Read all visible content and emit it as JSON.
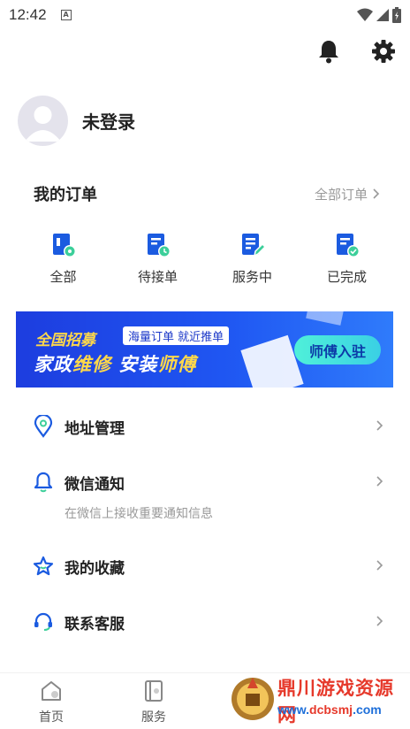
{
  "status_bar": {
    "time": "12:42",
    "notice_glyph": "A"
  },
  "topbar": {
    "icons": [
      "bell-icon",
      "gear-icon"
    ]
  },
  "profile": {
    "name": "未登录"
  },
  "orders": {
    "title": "我的订单",
    "all_label": "全部订单",
    "items": [
      {
        "label": "全部",
        "icon": "document-eye-icon"
      },
      {
        "label": "待接单",
        "icon": "document-clock-icon"
      },
      {
        "label": "服务中",
        "icon": "document-edit-icon"
      },
      {
        "label": "已完成",
        "icon": "document-check-icon"
      }
    ]
  },
  "banner": {
    "tag1": "全国招募",
    "tag2": "海量订单 就近推单",
    "main_a": "家政",
    "main_b": "维修",
    "main_c": " 安装",
    "main_d": "师傅",
    "button": "师傅入驻"
  },
  "menu": {
    "address": "地址管理",
    "wechat": "微信通知",
    "wechat_sub": "在微信上接收重要通知信息",
    "favorites": "我的收藏",
    "support": "联系客服"
  },
  "tabbar": {
    "tabs": [
      {
        "label": "首页",
        "icon": "home-icon"
      },
      {
        "label": "服务",
        "icon": "service-icon"
      }
    ]
  },
  "watermark": {
    "title": "鼎川游戏资源网",
    "url_a": "www.",
    "url_b": "dcbsmj",
    "url_c": ".com"
  },
  "colors": {
    "accent": "#1b5be0",
    "banner_start": "#1d3ddf",
    "banner_end": "#2f7bfb",
    "highlight": "#ffd84a"
  }
}
